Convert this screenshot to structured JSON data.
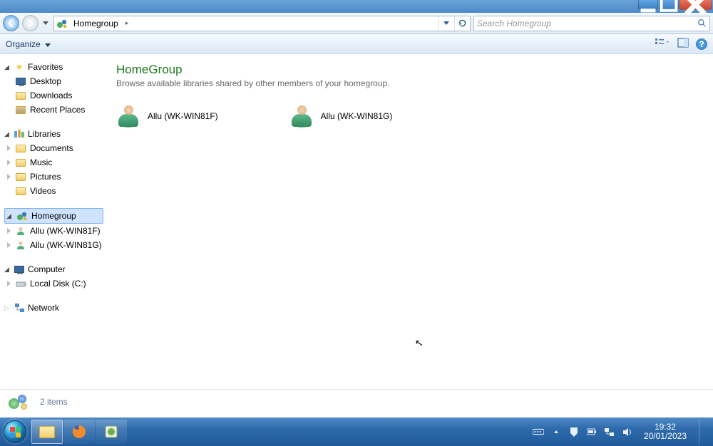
{
  "window": {
    "min": "–",
    "max": "❐",
    "close": "✕"
  },
  "address": {
    "location": "Homegroup",
    "sep": "▸"
  },
  "search": {
    "placeholder": "Search Homegroup"
  },
  "toolbar": {
    "organize": "Organize"
  },
  "sidebar": {
    "favorites": {
      "label": "Favorites",
      "items": [
        "Desktop",
        "Downloads",
        "Recent Places"
      ]
    },
    "libraries": {
      "label": "Libraries",
      "items": [
        "Documents",
        "Music",
        "Pictures",
        "Videos"
      ]
    },
    "homegroup": {
      "label": "Homegroup",
      "items": [
        "Allu (WK-WIN81F)",
        "Allu (WK-WIN81G)"
      ]
    },
    "computer": {
      "label": "Computer",
      "items": [
        "Local Disk (C:)"
      ]
    },
    "network": {
      "label": "Network"
    }
  },
  "content": {
    "title": "HomeGroup",
    "subtitle": "Browse available libraries shared by other members of your homegroup.",
    "members": [
      "Allu (WK-WIN81F)",
      "Allu (WK-WIN81G)"
    ]
  },
  "status": {
    "count": "2 items"
  },
  "taskbar": {
    "time": "19:32",
    "date": "20/01/2023"
  }
}
